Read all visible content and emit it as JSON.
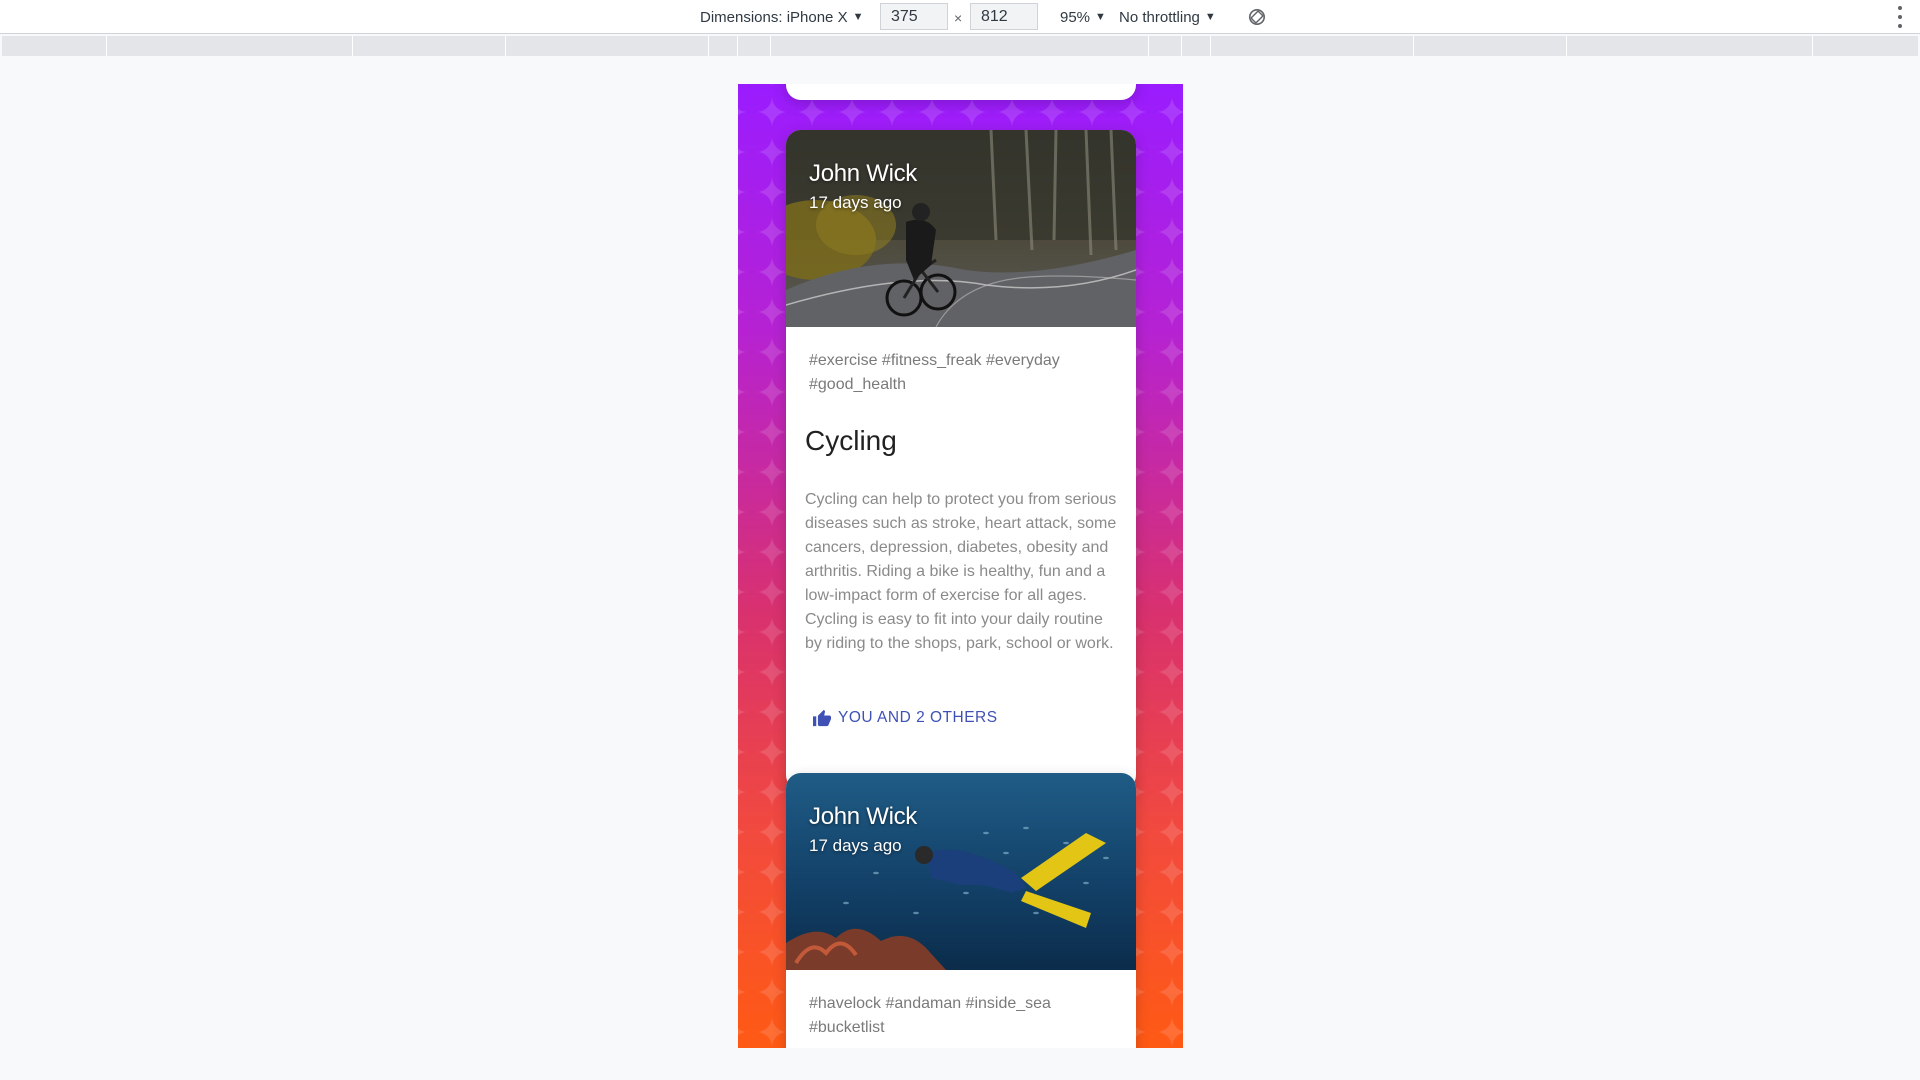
{
  "devtools": {
    "device_label": "Dimensions: iPhone X",
    "width": "375",
    "height": "812",
    "dim_separator": "×",
    "zoom": "95%",
    "throttling": "No throttling",
    "rotate_icon": "rotate-icon",
    "menu_icon": "more-vert-icon"
  },
  "page": {
    "background_colors": [
      "#9a1cff",
      "#d9316e",
      "#ff5a14"
    ],
    "posts": [
      {
        "author": "John Wick",
        "date": "17 days ago",
        "image": "cyclist-on-road",
        "tags": "#exercise #fitness_freak #everyday #good_health",
        "title": "Cycling",
        "description": "Cycling can help to protect you from serious diseases such as stroke, heart attack, some cancers, depression, diabetes, obesity and arthritis. Riding a bike is healthy, fun and a low-impact form of exercise for all ages. Cycling is easy to fit into your daily routine by riding to the shops, park, school or work.",
        "like_label": "YOU AND 2 OTHERS",
        "like_icon": "thumb-up-icon"
      },
      {
        "author": "John Wick",
        "date": "17 days ago",
        "image": "scuba-diver-underwater",
        "tags": "#havelock #andaman #inside_sea #bucketlist"
      }
    ],
    "accent_color": "#3f51b5"
  }
}
